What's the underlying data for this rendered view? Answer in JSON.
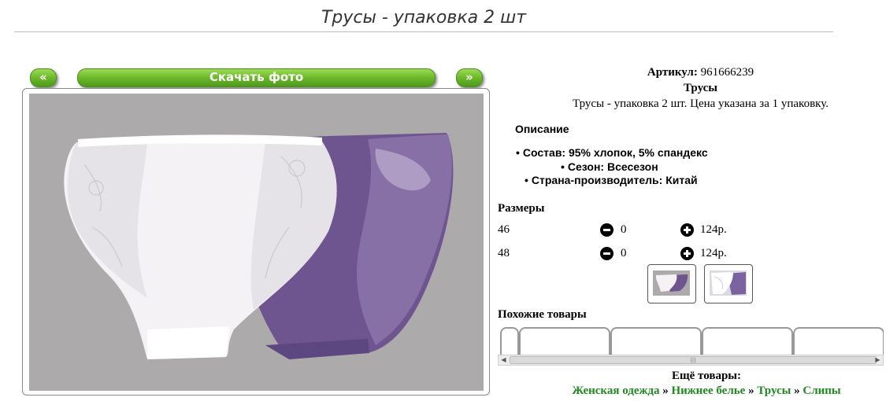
{
  "header": {
    "title": "Трусы - упаковка 2 шт"
  },
  "gallery": {
    "prev_label": "«",
    "download_label": "Скачать фото",
    "next_label": "»"
  },
  "product": {
    "article_label": "Артикул:",
    "article_value": "961666239",
    "name": "Трусы",
    "description": "Трусы - упаковка 2 шт. Цена указана за 1 упаковку.",
    "description_heading": "Описание",
    "properties": [
      "Состав: 95% хлопок, 5% спандекс",
      "Сезон: Всесезон",
      "Страна-производитель: Китай"
    ]
  },
  "sizes": {
    "heading": "Размеры",
    "rows": [
      {
        "size": "46",
        "qty": "0",
        "price": "124р."
      },
      {
        "size": "48",
        "qty": "0",
        "price": "124р."
      }
    ]
  },
  "similar": {
    "heading": "Похожие товары"
  },
  "more": {
    "heading": "Ещё товары:",
    "links": [
      "Женская одежда",
      "Нижнее белье",
      "Трусы",
      "Слипы"
    ],
    "separator": "»"
  },
  "colors": {
    "link_green": "#1e8a1e",
    "button_green": "#6cb72a",
    "photo_bg": "#adaaab"
  }
}
